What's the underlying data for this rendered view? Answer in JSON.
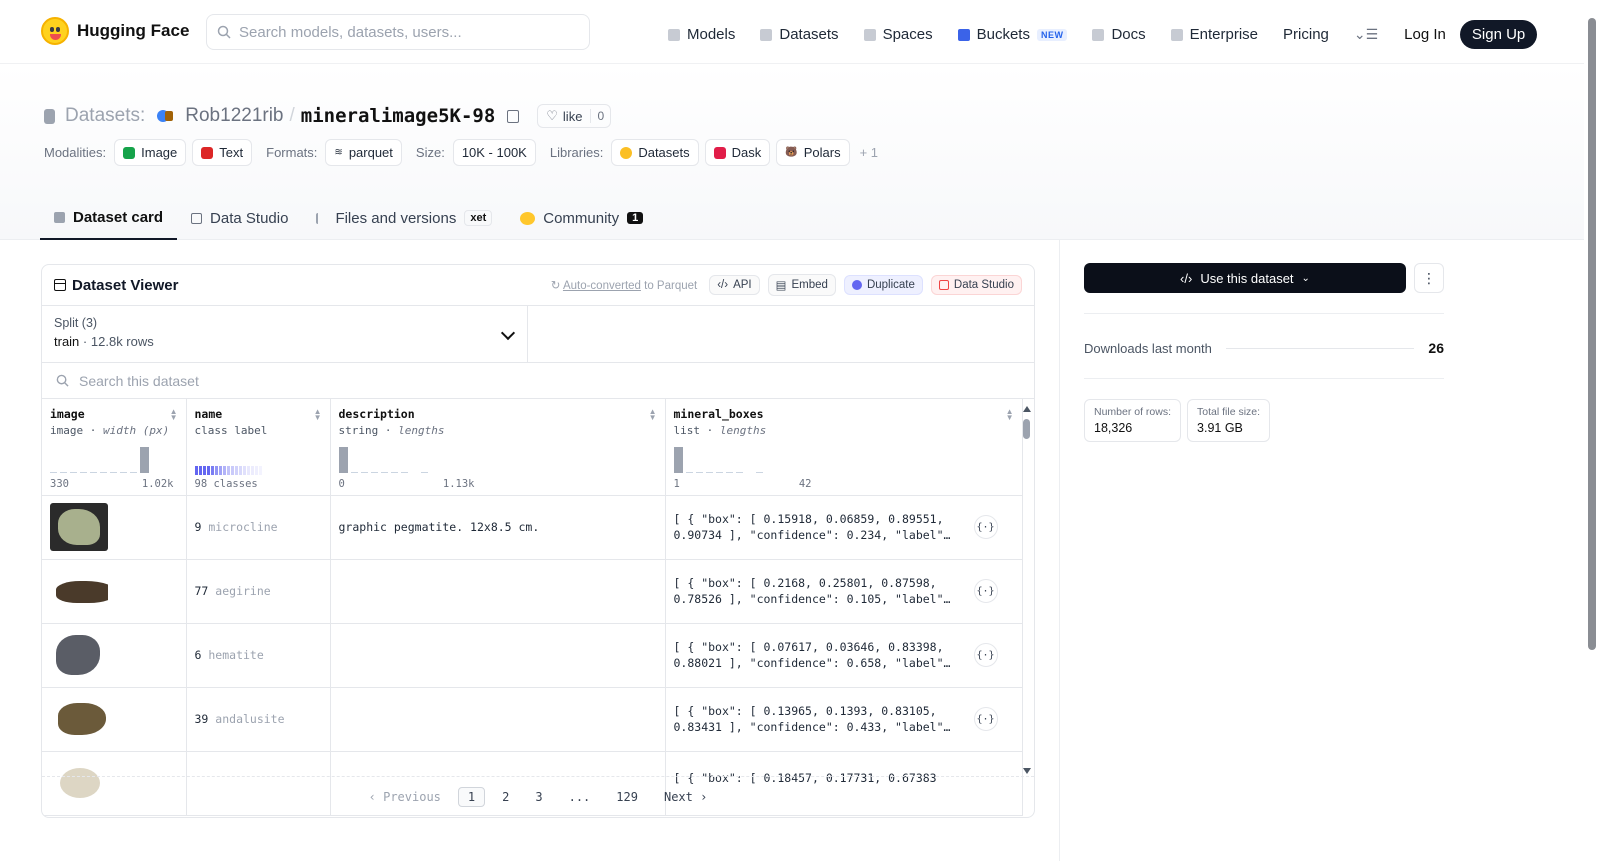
{
  "nav": {
    "brand": "Hugging Face",
    "search_placeholder": "Search models, datasets, users...",
    "links": [
      "Models",
      "Datasets",
      "Spaces",
      "Buckets",
      "Docs",
      "Enterprise",
      "Pricing"
    ],
    "buckets_badge": "NEW",
    "login": "Log In",
    "signup": "Sign Up"
  },
  "repo": {
    "prefix": "Datasets:",
    "user": "Rob1221rib",
    "separator": "/",
    "name": "mineralimage5K-98",
    "like_label": "like",
    "like_count": "0"
  },
  "meta": {
    "modalities_label": "Modalities:",
    "modalities": [
      "Image",
      "Text"
    ],
    "formats_label": "Formats:",
    "format": "parquet",
    "size_label": "Size:",
    "size": "10K - 100K",
    "libraries_label": "Libraries:",
    "libraries": [
      "Datasets",
      "Dask",
      "Polars"
    ],
    "libraries_more": "+ 1"
  },
  "tabs": {
    "dataset_card": "Dataset card",
    "data_studio": "Data Studio",
    "files": "Files and versions",
    "xet": "xet",
    "community": "Community",
    "community_count": "1"
  },
  "viewer": {
    "title": "Dataset Viewer",
    "auto_converted": "Auto-converted",
    "to_parquet": "to Parquet",
    "api": "API",
    "embed": "Embed",
    "duplicate": "Duplicate",
    "data_studio": "Data Studio",
    "split_label": "Split (3)",
    "split_value": "train",
    "split_rows": "12.8k rows",
    "search_placeholder": "Search this dataset",
    "columns": [
      {
        "name": "image",
        "type": "image",
        "subtype": "width (px)",
        "min": "330",
        "max": "1.02k"
      },
      {
        "name": "name",
        "type": "class label",
        "subtype": "",
        "min": "98 classes",
        "max": ""
      },
      {
        "name": "description",
        "type": "string",
        "subtype": "lengths",
        "min": "0",
        "max": "1.13k"
      },
      {
        "name": "mineral_boxes",
        "type": "list",
        "subtype": "lengths",
        "min": "1",
        "max": "42"
      }
    ],
    "rows": [
      {
        "class_id": "9",
        "class_name": "microcline",
        "description": "graphic pegmatite. 12x8.5 cm.",
        "boxes": "[ { \"box\": [ 0.15918, 0.06859, 0.89551, 0.90734 ], \"confidence\": 0.234, \"label\"…"
      },
      {
        "class_id": "77",
        "class_name": "aegirine",
        "description": "",
        "boxes": "[ { \"box\": [ 0.2168, 0.25801, 0.87598, 0.78526 ], \"confidence\": 0.105, \"label\"…"
      },
      {
        "class_id": "6",
        "class_name": "hematite",
        "description": "",
        "boxes": "[ { \"box\": [ 0.07617, 0.03646, 0.83398, 0.88021 ], \"confidence\": 0.658, \"label\"…"
      },
      {
        "class_id": "39",
        "class_name": "andalusite",
        "description": "",
        "boxes": "[ { \"box\": [ 0.13965, 0.1393, 0.83105, 0.83431 ], \"confidence\": 0.433, \"label\"…"
      },
      {
        "class_id": "",
        "class_name": "",
        "description": "",
        "boxes": "[ { \"box\": [ 0.18457, 0.17731, 0.67383"
      }
    ],
    "pager": {
      "prev": "Previous",
      "pages": [
        "1",
        "2",
        "3",
        "...",
        "129"
      ],
      "next": "Next"
    }
  },
  "sidebar": {
    "use_button": "Use this dataset",
    "downloads_label": "Downloads last month",
    "downloads_value": "26",
    "rows_label": "Number of rows:",
    "rows_value": "18,326",
    "size_label": "Total file size:",
    "size_value": "3.91 GB"
  }
}
